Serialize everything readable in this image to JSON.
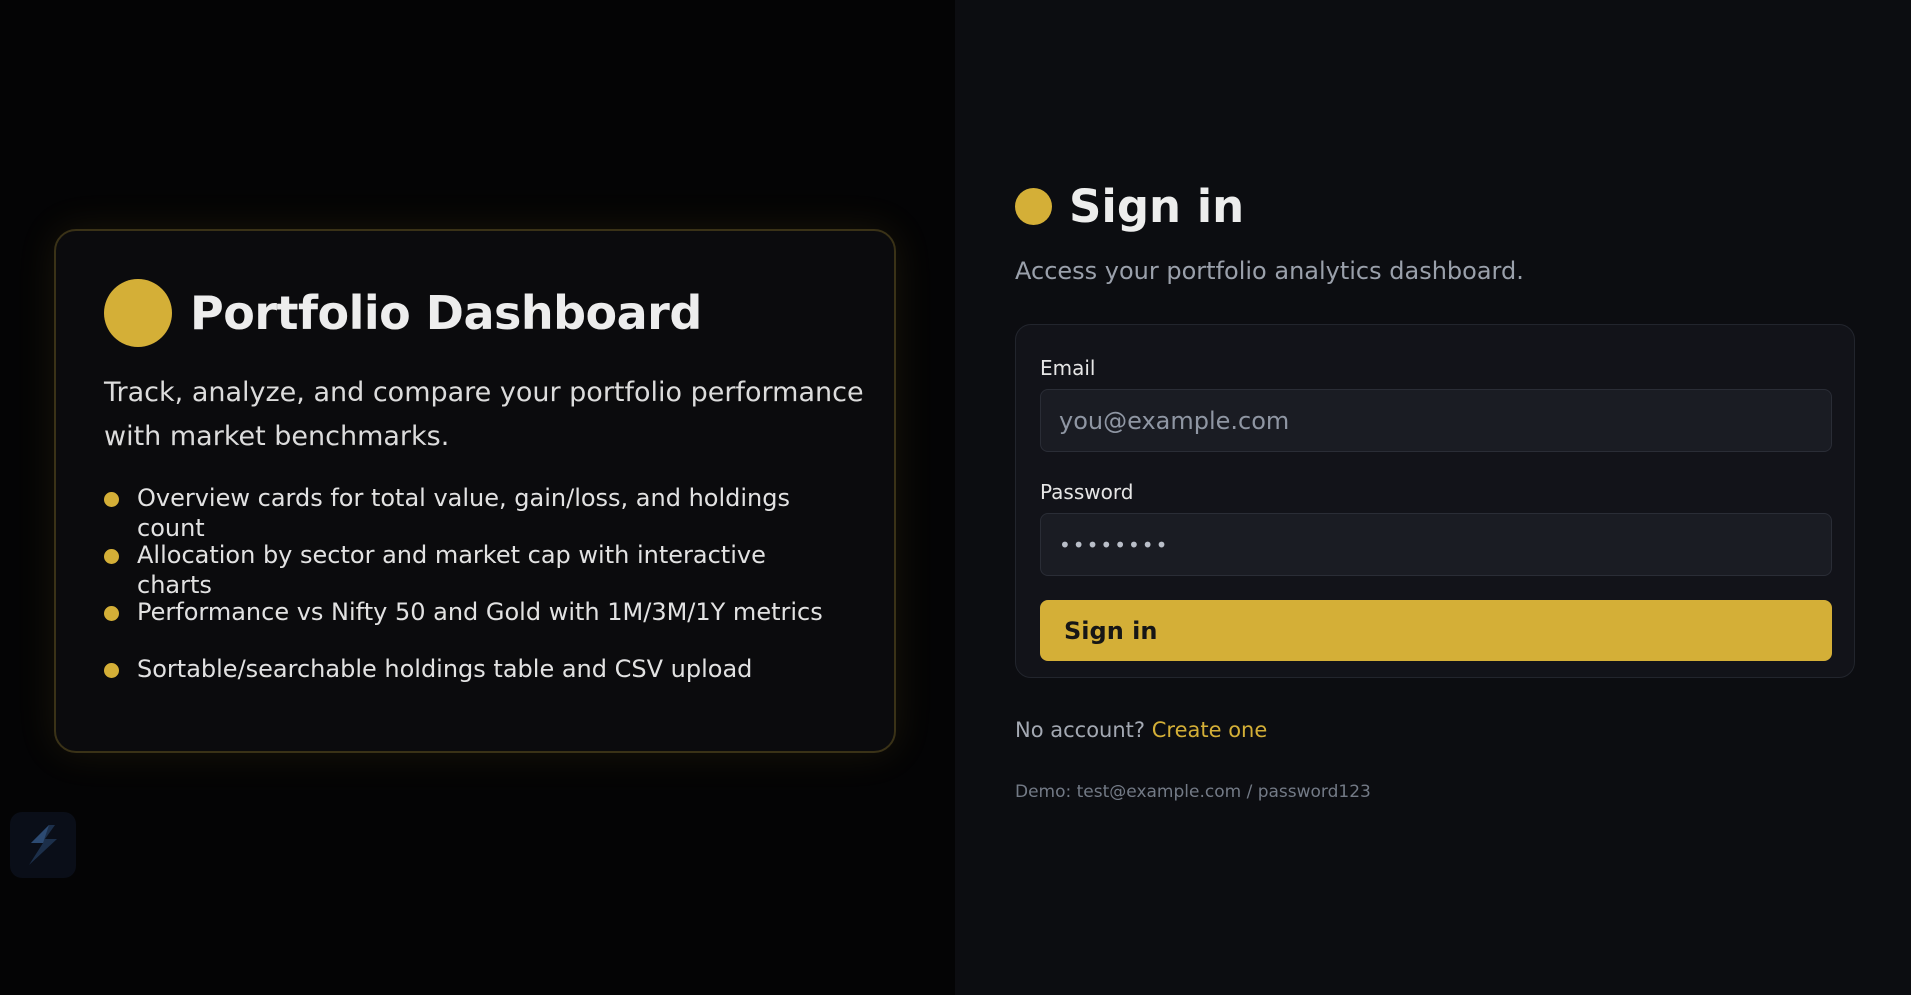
{
  "hero": {
    "title": "Portfolio Dashboard",
    "description": "Track, analyze, and compare your portfolio performance with market benchmarks.",
    "features": [
      "Overview cards for total value, gain/loss, and holdings count",
      "Allocation by sector and market cap with interactive charts",
      "Performance vs Nifty 50 and Gold with 1M/3M/1Y metrics",
      "Sortable/searchable holdings table and CSV upload"
    ]
  },
  "signin": {
    "title": "Sign in",
    "subtitle": "Access your portfolio analytics dashboard.",
    "email_label": "Email",
    "email_placeholder": "you@example.com",
    "password_label": "Password",
    "password_value": "••••••••",
    "submit_label": "Sign in",
    "no_account_text": "No account?",
    "create_link": "Create one",
    "demo_note": "Demo: test@example.com / password123"
  },
  "colors": {
    "accent": "#d4af37",
    "left_bg": "#040405",
    "right_bg": "#0c0d11",
    "card_bg": "#121319"
  },
  "icons": {
    "brand": "circle-logo-icon",
    "bullet": "dot-bullet-icon",
    "side_badge": "bolt-badge-icon"
  }
}
